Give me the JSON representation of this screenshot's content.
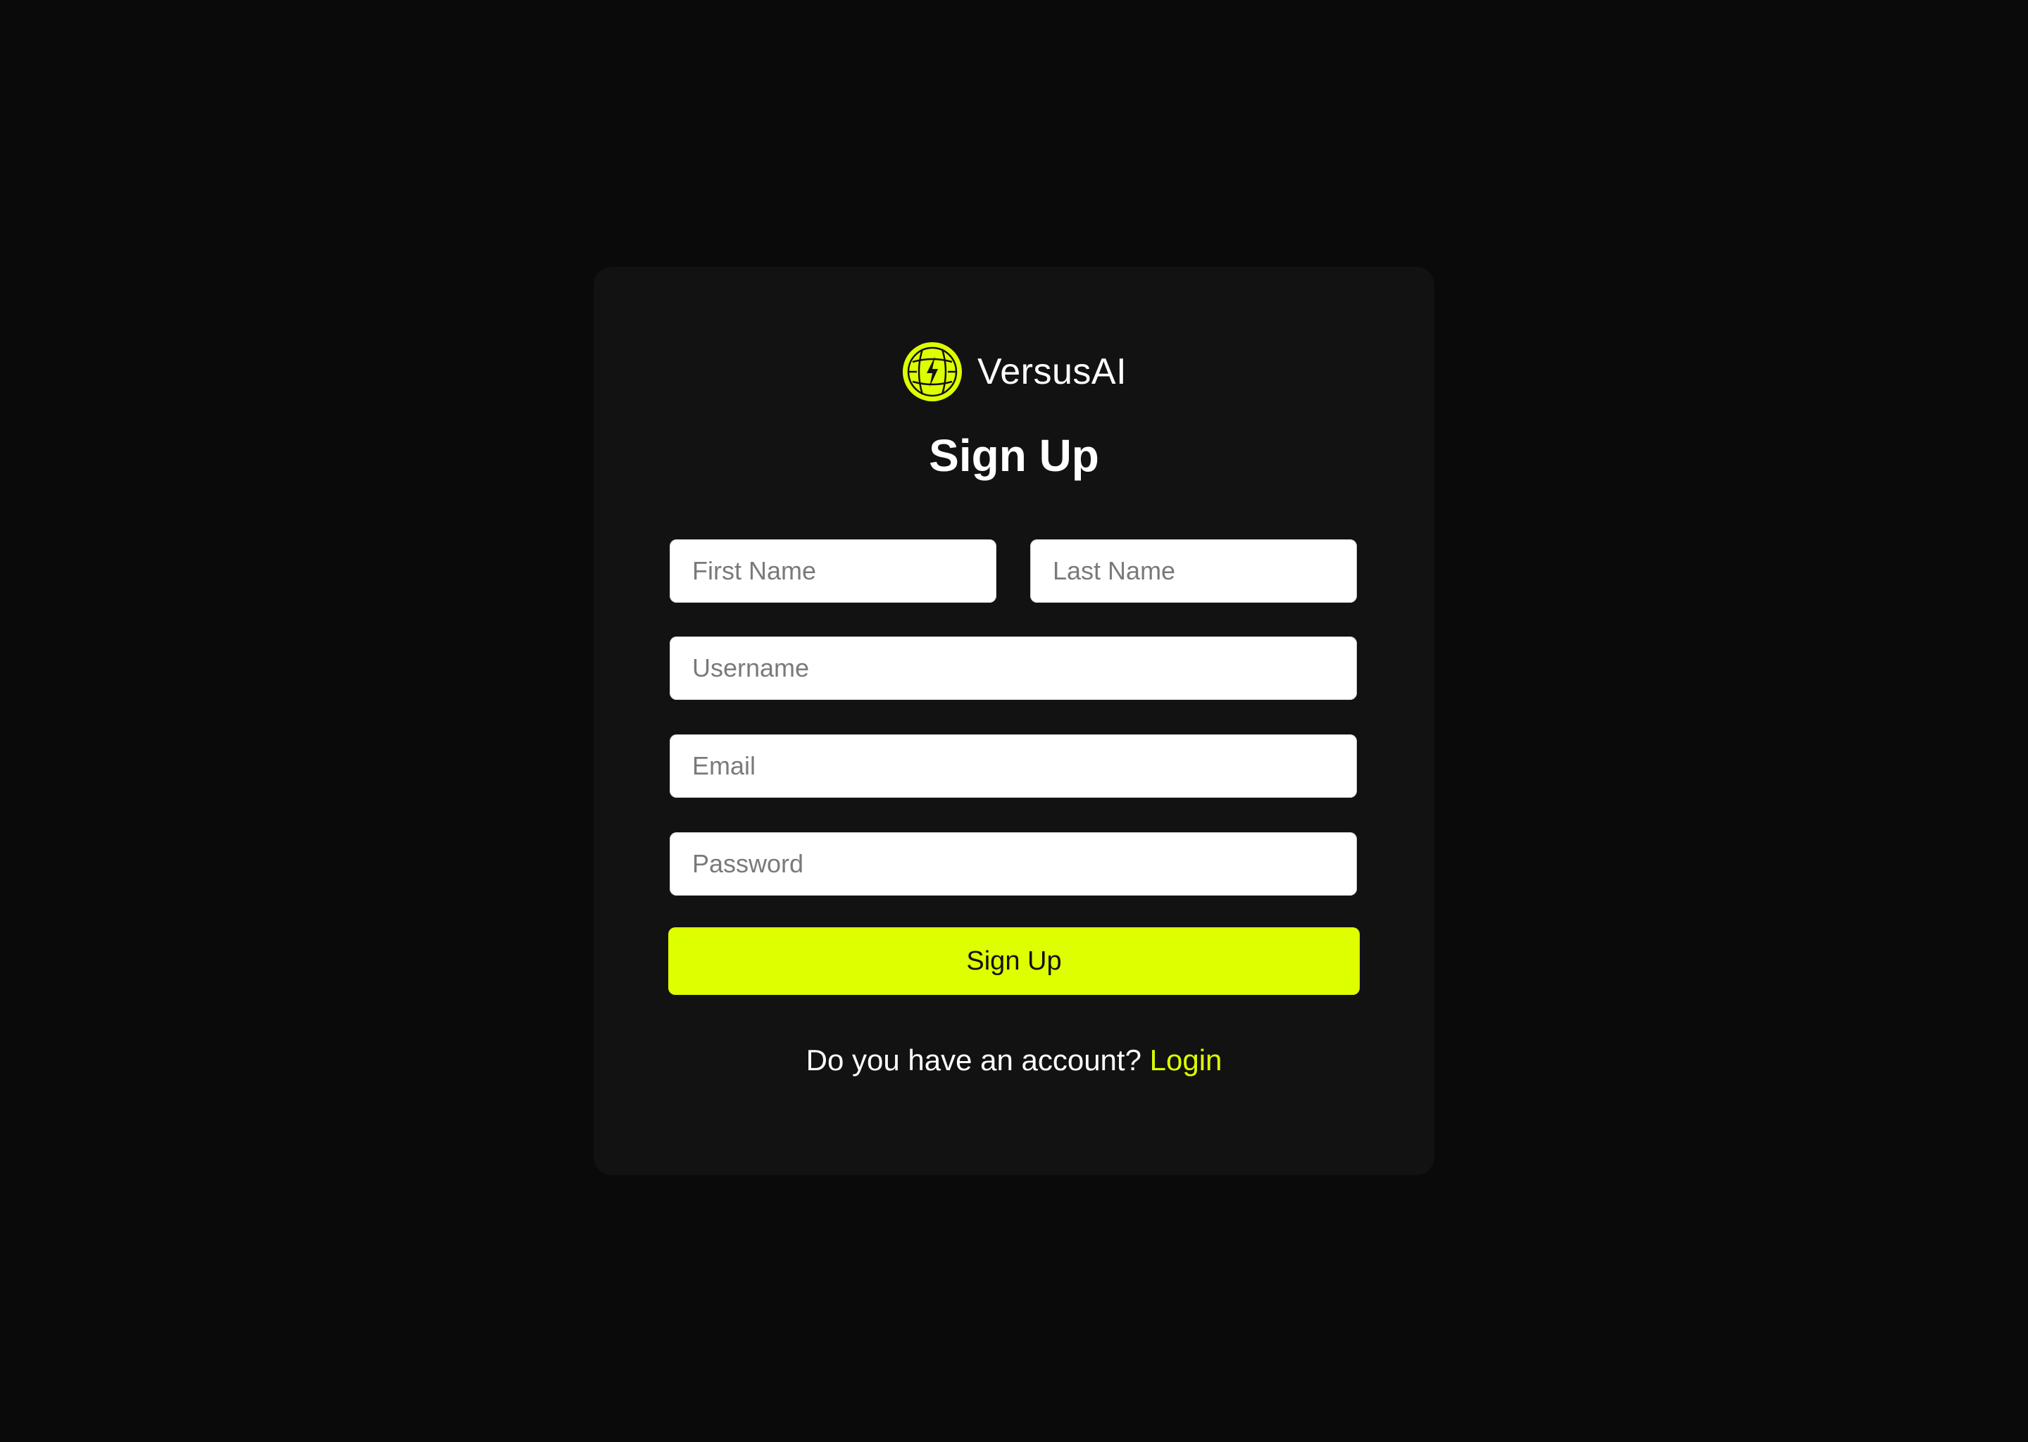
{
  "brand": {
    "name": "VersusAI",
    "icon": "versus-globe-bolt-icon"
  },
  "title": "Sign Up",
  "form": {
    "first_name": {
      "value": "",
      "placeholder": "First Name"
    },
    "last_name": {
      "value": "",
      "placeholder": "Last Name"
    },
    "username": {
      "value": "",
      "placeholder": "Username"
    },
    "email": {
      "value": "",
      "placeholder": "Email"
    },
    "password": {
      "value": "",
      "placeholder": "Password"
    },
    "submit_label": "Sign Up"
  },
  "footer": {
    "prompt": "Do you have an account?",
    "login_label": "Login"
  },
  "colors": {
    "background": "#0a0a0a",
    "card": "#121212",
    "accent": "#deff00",
    "text": "#ffffff"
  }
}
